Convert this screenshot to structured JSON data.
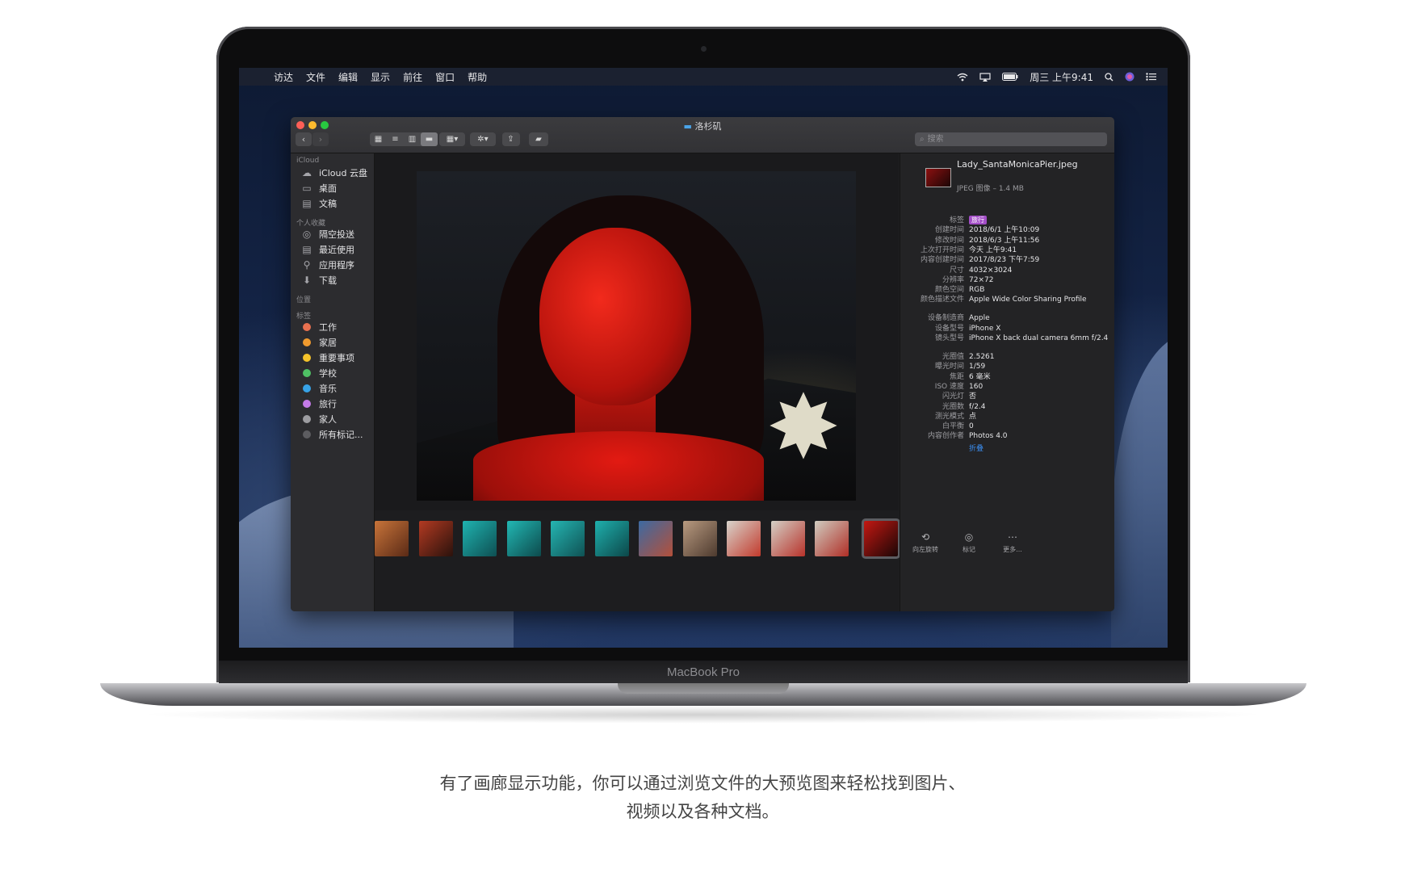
{
  "device": {
    "model_label": "MacBook Pro"
  },
  "menubar": {
    "apple": "",
    "items": [
      "访达",
      "文件",
      "编辑",
      "显示",
      "前往",
      "窗口",
      "帮助"
    ],
    "clock": "周三 上午9:41"
  },
  "finder": {
    "title": "洛杉矶",
    "search_placeholder": "搜索",
    "sidebar": {
      "icloud_header": "iCloud",
      "icloud_items": [
        {
          "label": "iCloud 云盘",
          "icon": "cloud-icon"
        },
        {
          "label": "桌面",
          "icon": "desktop-icon"
        },
        {
          "label": "文稿",
          "icon": "document-icon"
        }
      ],
      "favorites_header": "个人收藏",
      "favorites_items": [
        {
          "label": "隔空投送",
          "icon": "airdrop-icon"
        },
        {
          "label": "最近使用",
          "icon": "recents-icon"
        },
        {
          "label": "应用程序",
          "icon": "applications-icon"
        },
        {
          "label": "下载",
          "icon": "downloads-icon"
        }
      ],
      "locations_header": "位置",
      "tags_header": "标签",
      "tags": [
        {
          "label": "工作",
          "color": "#e8704f"
        },
        {
          "label": "家居",
          "color": "#f09a2e"
        },
        {
          "label": "重要事项",
          "color": "#f5c32a"
        },
        {
          "label": "学校",
          "color": "#4fc064"
        },
        {
          "label": "音乐",
          "color": "#37a2e6"
        },
        {
          "label": "旅行",
          "color": "#c47ae8"
        },
        {
          "label": "家人",
          "color": "#9c9ca0"
        },
        {
          "label": "所有标记...",
          "color": "#5c5c60"
        }
      ]
    },
    "inspector": {
      "file_name": "Lady_SantaMonicaPier.jpeg",
      "file_type": "JPEG 图像 – 1.4 MB",
      "metadata": [
        {
          "key": "标签",
          "value": "旅行",
          "is_tag": true
        },
        {
          "key": "创建时间",
          "value": "2018/6/1 上午10:09"
        },
        {
          "key": "修改时间",
          "value": "2018/6/3 上午11:56"
        },
        {
          "key": "上次打开时间",
          "value": "今天 上午9:41"
        },
        {
          "key": "内容创建时间",
          "value": "2017/8/23 下午7:59"
        },
        {
          "key": "尺寸",
          "value": "4032×3024"
        },
        {
          "key": "分辨率",
          "value": "72×72"
        },
        {
          "key": "颜色空间",
          "value": "RGB"
        },
        {
          "key": "颜色描述文件",
          "value": "Apple Wide Color Sharing Profile"
        },
        {
          "key": "设备制造商",
          "value": "Apple"
        },
        {
          "key": "设备型号",
          "value": "iPhone X"
        },
        {
          "key": "镜头型号",
          "value": "iPhone X back dual camera 6mm f/2.4"
        },
        {
          "key": "光圈值",
          "value": "2.5261"
        },
        {
          "key": "曝光时间",
          "value": "1/59"
        },
        {
          "key": "焦距",
          "value": "6 毫米"
        },
        {
          "key": "ISO 速度",
          "value": "160"
        },
        {
          "key": "闪光灯",
          "value": "否"
        },
        {
          "key": "光圈数",
          "value": "f/2.4"
        },
        {
          "key": "测光模式",
          "value": "点"
        },
        {
          "key": "白平衡",
          "value": "0"
        },
        {
          "key": "内容创作者",
          "value": "Photos 4.0"
        }
      ],
      "collapse_label": "折叠",
      "actions": [
        {
          "label": "向左旋转",
          "icon": "rotate-left-icon"
        },
        {
          "label": "标记",
          "icon": "markup-icon"
        },
        {
          "label": "更多...",
          "icon": "more-icon"
        }
      ]
    },
    "thumbnails": [
      {
        "colors": [
          "#c8743a",
          "#5a2a16"
        ]
      },
      {
        "colors": [
          "#b33a22",
          "#2a120c"
        ]
      },
      {
        "colors": [
          "#1fb3b0",
          "#0e4f52"
        ]
      },
      {
        "colors": [
          "#22b8b4",
          "#0d4a4c"
        ]
      },
      {
        "colors": [
          "#25b5b2",
          "#0f5254"
        ]
      },
      {
        "colors": [
          "#1fb0ad",
          "#0c4749"
        ]
      },
      {
        "colors": [
          "#3c6aa2",
          "#b4503a"
        ]
      },
      {
        "colors": [
          "#b89a80",
          "#4d3a2e"
        ]
      },
      {
        "colors": [
          "#d8d4cc",
          "#c23a2c"
        ]
      },
      {
        "colors": [
          "#d4d0c6",
          "#b8322a"
        ]
      },
      {
        "colors": [
          "#d0ccc0",
          "#b02e26"
        ]
      },
      {
        "colors": [
          "#c41812",
          "#1a0606"
        ],
        "selected": true
      }
    ]
  },
  "caption": {
    "line1": "有了画廊显示功能，你可以通过浏览文件的大预览图来轻松找到图片、",
    "line2": "视频以及各种文档。"
  }
}
